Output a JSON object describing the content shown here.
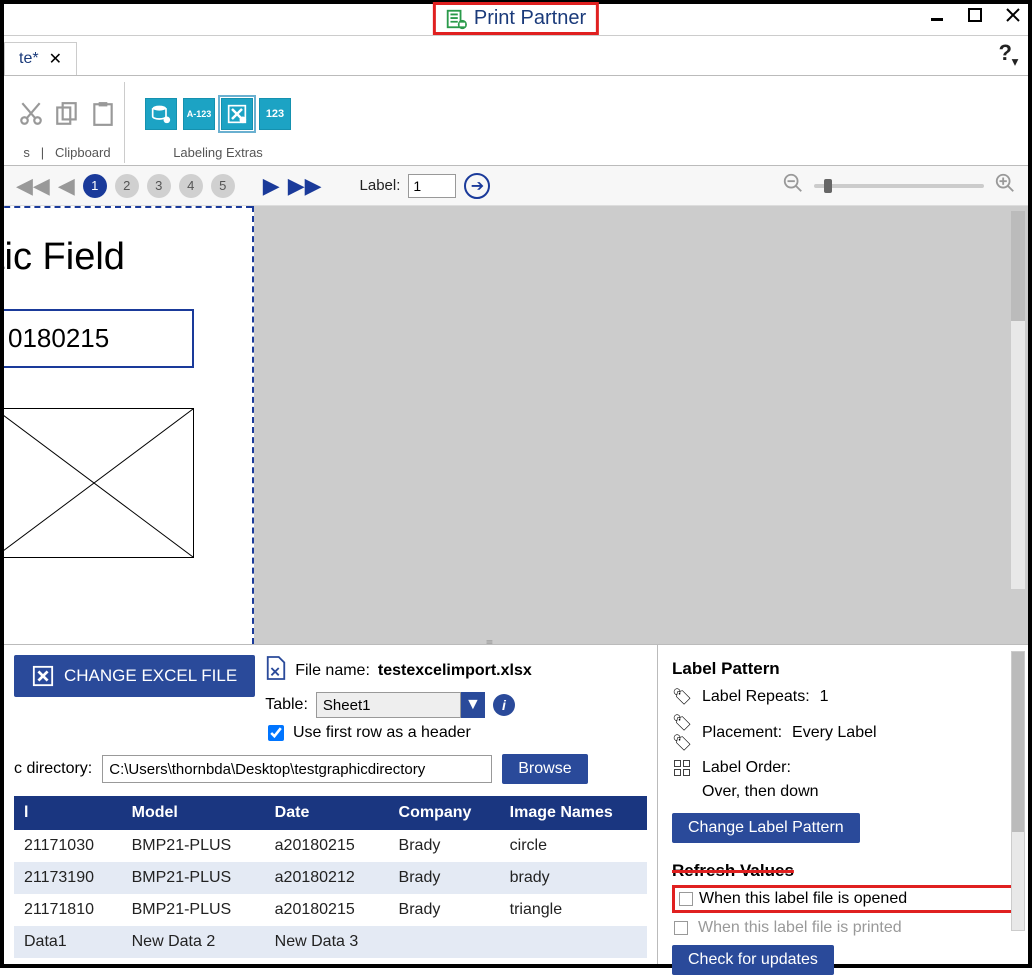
{
  "title": "Print Partner",
  "tab": {
    "label": "te*",
    "close_glyph": "✕"
  },
  "ribbon": {
    "group_s_label": "s",
    "clipboard_label": "Clipboard",
    "extras_label": "Labeling Extras"
  },
  "nav": {
    "pages": [
      "1",
      "2",
      "3",
      "4",
      "5"
    ],
    "active_page": 0,
    "label_text": "Label:",
    "label_value": "1"
  },
  "canvas": {
    "title_text": "tic Field",
    "field_value": "0180215"
  },
  "excel": {
    "change_btn": "CHANGE EXCEL FILE",
    "file_label": "File name:",
    "file_value": "testexcelimport.xlsx",
    "table_label": "Table:",
    "table_value": "Sheet1",
    "header_chk": "Use first row as a header",
    "dir_label": "c directory:",
    "dir_value": "C:\\Users\\thornbda\\Desktop\\testgraphicdirectory",
    "browse_btn": "Browse"
  },
  "table": {
    "headers": [
      "l",
      "Model",
      "Date",
      "Company",
      "Image Names"
    ],
    "rows": [
      [
        "21171030",
        "BMP21-PLUS",
        "a20180215",
        "Brady",
        "circle"
      ],
      [
        "21173190",
        "BMP21-PLUS",
        "a20180212",
        "Brady",
        "brady"
      ],
      [
        "21171810",
        "BMP21-PLUS",
        "a20180215",
        "Brady",
        "triangle"
      ],
      [
        "Data1",
        "New Data 2",
        "New Data 3",
        "",
        ""
      ]
    ]
  },
  "pattern": {
    "heading": "Label Pattern",
    "repeats_label": "Label Repeats:",
    "repeats_value": "1",
    "placement_label": "Placement:",
    "placement_value": "Every Label",
    "order_label": "Label Order:",
    "order_value": "Over, then down",
    "change_btn": "Change Label Pattern",
    "refresh_heading": "Refresh Values",
    "refresh_opened": "When this label file is opened",
    "refresh_printed": "When this label file is printed",
    "check_btn": "Check for updates"
  }
}
